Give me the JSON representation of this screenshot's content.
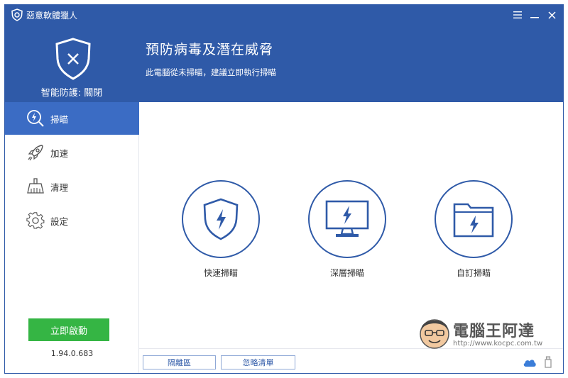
{
  "app": {
    "title": "惡意軟體獵人",
    "protect_status": "智能防護: 關閉",
    "headline": "預防病毒及潛在威脅",
    "subline": "此電腦從未掃瞄，建議立即執行掃瞄",
    "accent_color": "#2f5aa8",
    "start_color": "#35b544"
  },
  "window_controls": [
    {
      "name": "menu-icon",
      "label": "☰"
    },
    {
      "name": "minimize-icon",
      "label": "—"
    },
    {
      "name": "close-icon",
      "label": "✕"
    }
  ],
  "sidebar": {
    "items": [
      {
        "label": "掃瞄",
        "icon": "scan-icon",
        "active": true
      },
      {
        "label": "加速",
        "icon": "rocket-icon",
        "active": false
      },
      {
        "label": "清理",
        "icon": "broom-icon",
        "active": false
      },
      {
        "label": "設定",
        "icon": "gear-icon",
        "active": false
      }
    ],
    "start_button": "立即啟動",
    "version": "1.94.0.683"
  },
  "scan_options": [
    {
      "label": "快速掃瞄",
      "icon": "shield-bolt-icon"
    },
    {
      "label": "深層掃瞄",
      "icon": "monitor-bolt-icon"
    },
    {
      "label": "自訂掃瞄",
      "icon": "folder-bolt-icon"
    }
  ],
  "bottom": {
    "quarantine": "隔離區",
    "ignore_list": "忽略清單"
  },
  "watermark": {
    "title": "電腦王阿達",
    "url": "http://www.kocpc.com.tw"
  }
}
